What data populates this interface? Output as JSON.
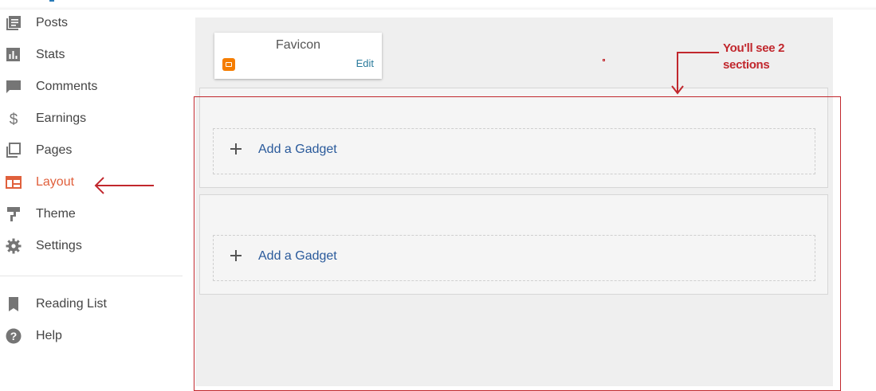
{
  "sidebar": {
    "items": [
      {
        "label": "Posts",
        "icon": "posts-icon"
      },
      {
        "label": "Stats",
        "icon": "stats-icon"
      },
      {
        "label": "Comments",
        "icon": "comments-icon"
      },
      {
        "label": "Earnings",
        "icon": "dollar-icon"
      },
      {
        "label": "Pages",
        "icon": "pages-icon"
      },
      {
        "label": "Layout",
        "icon": "layout-icon",
        "active": true
      },
      {
        "label": "Theme",
        "icon": "paint-roller-icon"
      },
      {
        "label": "Settings",
        "icon": "gear-icon"
      }
    ],
    "secondary": [
      {
        "label": "Reading List",
        "icon": "bookmark-icon"
      },
      {
        "label": "Help",
        "icon": "help-icon"
      }
    ]
  },
  "layout": {
    "favicon": {
      "title": "Favicon",
      "edit_label": "Edit"
    },
    "sections": [
      {
        "add_gadget_label": "Add a Gadget"
      },
      {
        "add_gadget_label": "Add a Gadget"
      }
    ]
  },
  "annotation": {
    "text": "You'll see 2 sections"
  },
  "colors": {
    "accent": "#e0603c",
    "annotation": "#c1272d",
    "link": "#2a5a9b"
  }
}
